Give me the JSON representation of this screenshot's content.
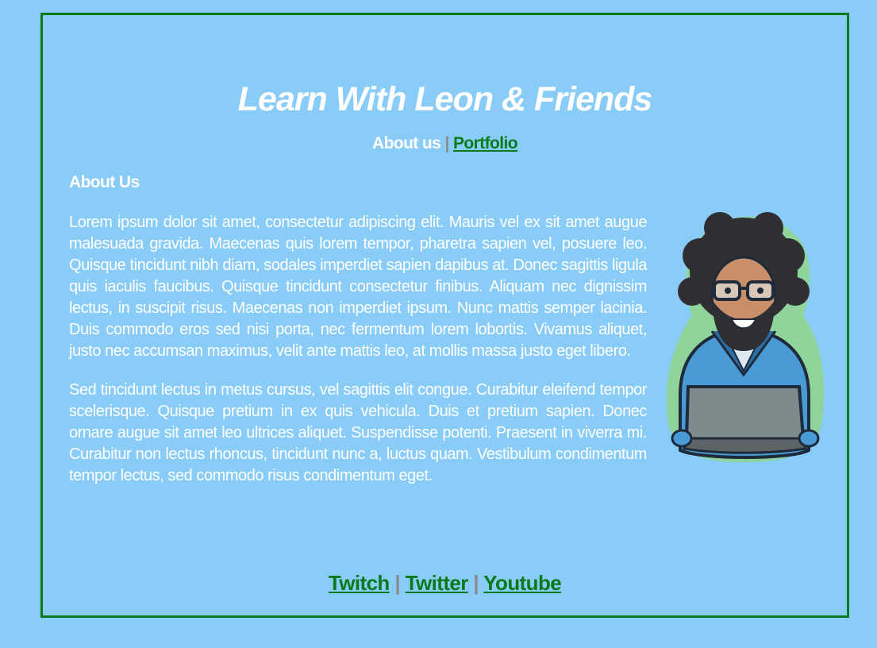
{
  "header": {
    "title": "Learn With Leon & Friends"
  },
  "nav": {
    "current_label": "About us",
    "separator": "|",
    "portfolio_label": "Portfolio"
  },
  "main": {
    "heading": "About Us",
    "paragraph_1": "Lorem ipsum dolor sit amet, consectetur adipiscing elit. Mauris vel ex sit amet augue malesuada gravida. Maecenas quis lorem tempor, pharetra sapien vel, posuere leo. Quisque tincidunt nibh diam, sodales imperdiet sapien dapibus at. Donec sagittis ligula quis iaculis faucibus. Quisque tincidunt consectetur finibus. Aliquam nec dignissim lectus, in suscipit risus. Maecenas non imperdiet ipsum. Nunc mattis semper lacinia. Duis commodo eros sed nisi porta, nec fermentum lorem lobortis. Vivamus aliquet, justo nec accumsan maximus, velit ante mattis leo, at mollis massa justo eget libero.",
    "paragraph_2": "Sed tincidunt lectus in metus cursus, vel sagittis elit congue. Curabitur eleifend tempor scelerisque. Quisque pretium in ex quis vehicula. Duis et pretium sapien. Donec ornare augue sit amet leo ultrices aliquet. Suspendisse potenti. Praesent in viverra mi. Curabitur non lectus rhoncus, tincidunt nunc a, luctus quam. Vestibulum condimentum tempor lectus, sed commodo risus condimentum eget."
  },
  "footer": {
    "twitch_label": "Twitch",
    "twitter_label": "Twitter",
    "youtube_label": "Youtube",
    "separator": "|"
  },
  "colors": {
    "background": "#89ccf8",
    "border": "#0b7a1a",
    "link": "#0b7a1a",
    "text": "#ffffff"
  },
  "icons": {
    "avatar": "developer-avatar-illustration"
  }
}
